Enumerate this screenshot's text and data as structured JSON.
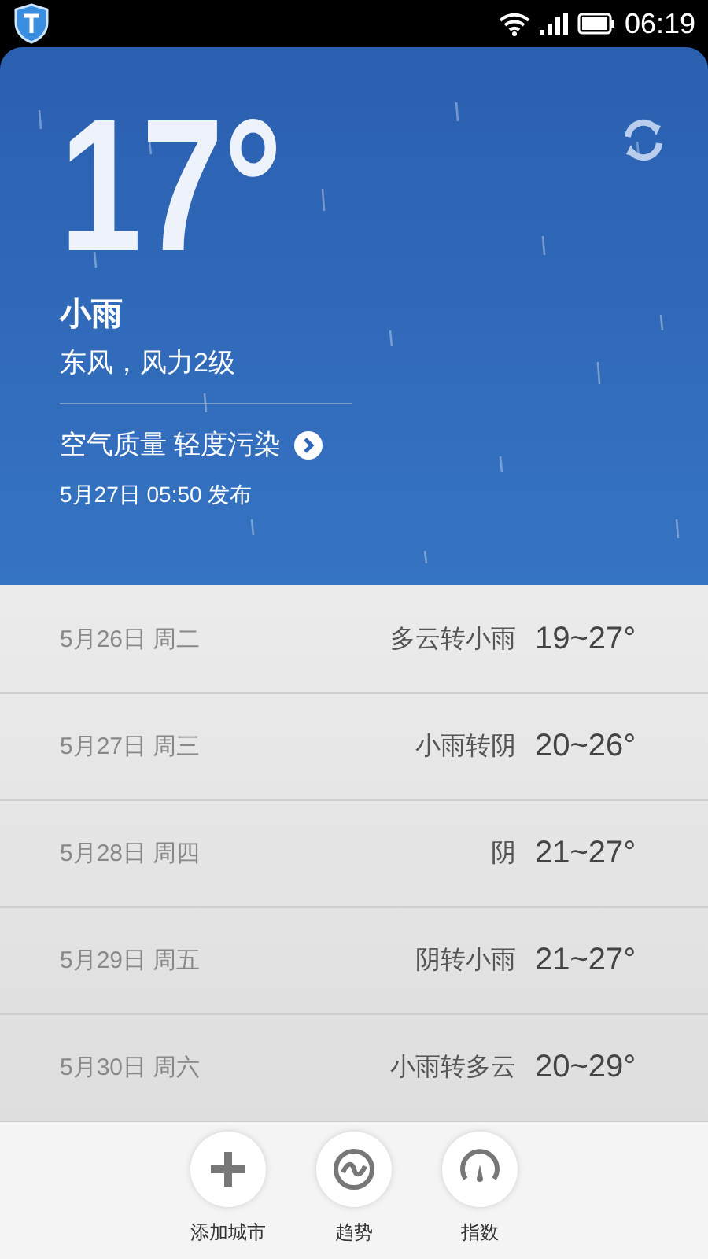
{
  "status_bar": {
    "time": "06:19"
  },
  "current": {
    "temperature": "17°",
    "condition": "小雨",
    "wind": "东风，风力2级",
    "air_quality": "空气质量 轻度污染",
    "published": "5月27日 05:50 发布"
  },
  "forecast": [
    {
      "date": "5月26日 周二",
      "weather": "多云转小雨",
      "range": "19~27°"
    },
    {
      "date": "5月27日 周三",
      "weather": "小雨转阴",
      "range": "20~26°"
    },
    {
      "date": "5月28日 周四",
      "weather": "阴",
      "range": "21~27°"
    },
    {
      "date": "5月29日 周五",
      "weather": "阴转小雨",
      "range": "21~27°"
    },
    {
      "date": "5月30日 周六",
      "weather": "小雨转多云",
      "range": "20~29°"
    }
  ],
  "toolbar": [
    {
      "kind": "add",
      "label": "添加城市"
    },
    {
      "kind": "trend",
      "label": "趋势"
    },
    {
      "kind": "index",
      "label": "指数"
    }
  ]
}
